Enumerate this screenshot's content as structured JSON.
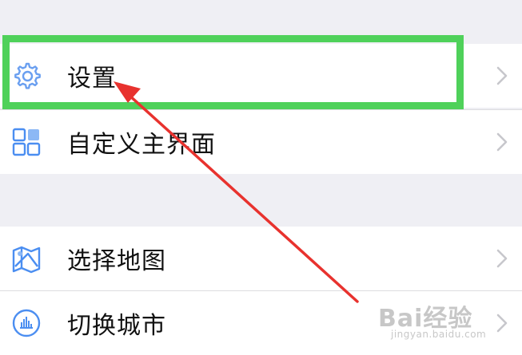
{
  "menu": {
    "group1": [
      {
        "label": "设置",
        "icon": "gear-icon",
        "chevron": "chevron-right-icon"
      },
      {
        "label": "自定义主界面",
        "icon": "grid-icon",
        "chevron": "chevron-right-icon"
      }
    ],
    "group2": [
      {
        "label": "选择地图",
        "icon": "map-icon",
        "chevron": "chevron-right-icon"
      },
      {
        "label": "切换城市",
        "icon": "city-icon",
        "chevron": "chevron-right-icon"
      }
    ]
  },
  "annotation": {
    "highlight_color": "#4fd15a",
    "arrow_color": "#e8322e"
  },
  "watermark": {
    "brand": "Bai经验",
    "url": "jingyan.baidu.com"
  },
  "colors": {
    "background": "#efeff4",
    "row": "#ffffff",
    "icon_blue": "#4b8ef1",
    "chevron": "#c7c7cc"
  }
}
